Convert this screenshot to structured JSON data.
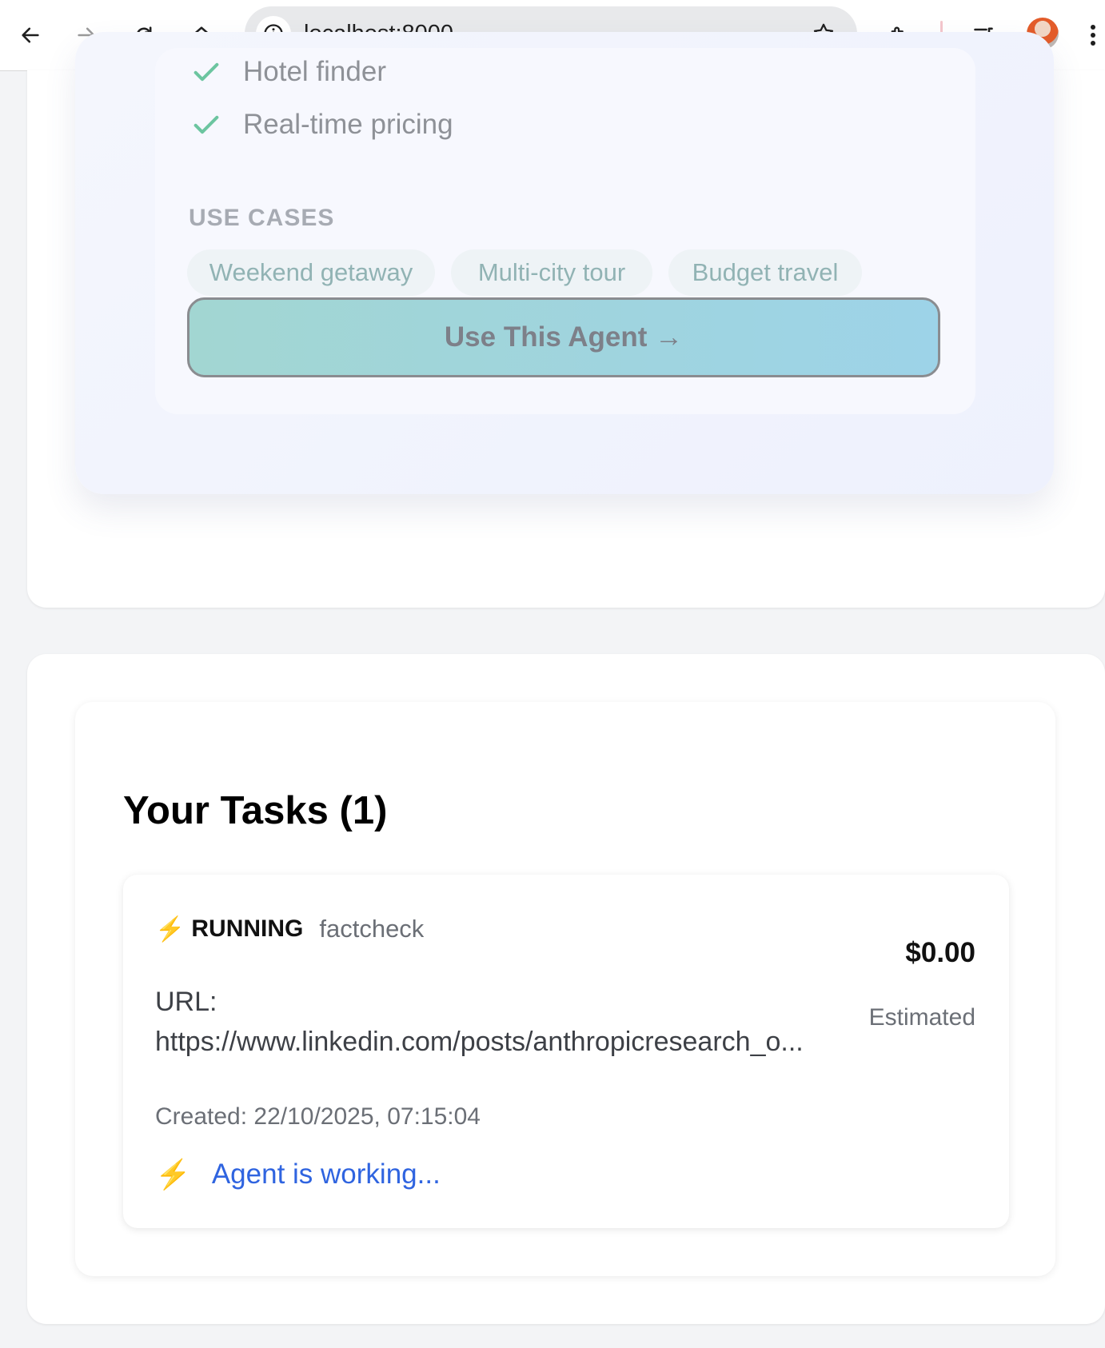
{
  "browser": {
    "url": "localhost:8000"
  },
  "agent_card": {
    "features": [
      "Hotel finder",
      "Real-time pricing"
    ],
    "use_cases_title": "USE CASES",
    "use_cases": [
      "Weekend getaway",
      "Multi-city tour",
      "Budget travel"
    ],
    "cta_label": "Use This Agent →"
  },
  "tasks": {
    "title": "Your Tasks (1)",
    "items": [
      {
        "status": "RUNNING",
        "type": "factcheck",
        "price": "$0.00",
        "price_note": "Estimated",
        "url_label": "URL:",
        "url_value": "https://www.linkedin.com/posts/anthropicresearch_o...",
        "created": "Created: 22/10/2025, 07:15:04",
        "progress_text": "Agent is working..."
      }
    ]
  },
  "colors": {
    "accent_check": "#6cc5a0",
    "link_blue": "#2f64e0",
    "bolt": "#f5b731"
  }
}
